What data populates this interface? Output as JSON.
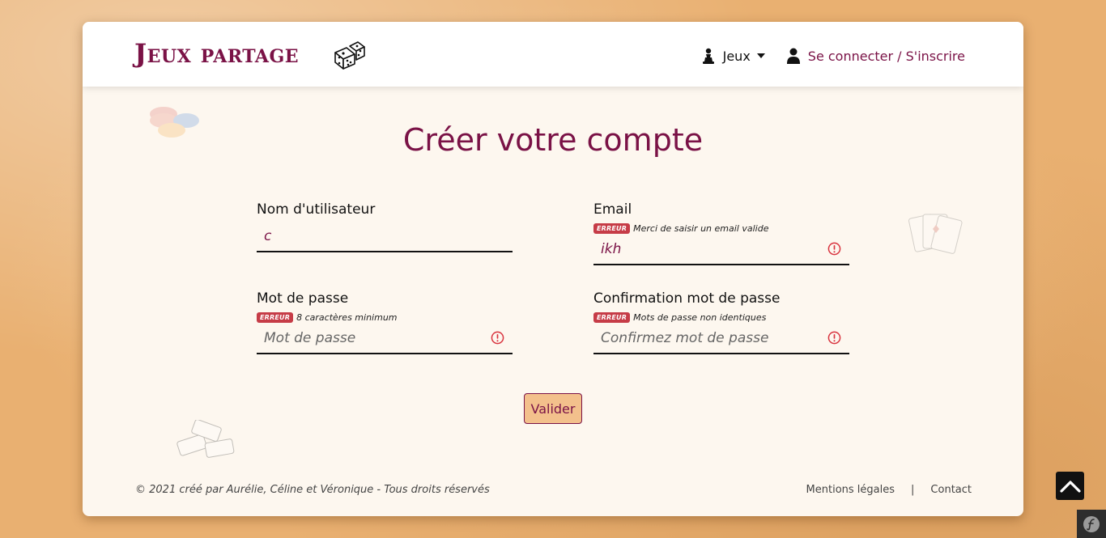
{
  "nav": {
    "brand": "Jeux partage",
    "games_label": "Jeux",
    "login_label": "Se connecter / S'inscrire"
  },
  "page": {
    "title": "Créer votre compte"
  },
  "form": {
    "username": {
      "label": "Nom d'utilisateur",
      "value": "c",
      "placeholder": ""
    },
    "email": {
      "label": "Email",
      "error_badge": "ERREUR",
      "error_text": "Merci de saisir un email valide",
      "value": "ikh",
      "placeholder": ""
    },
    "password": {
      "label": "Mot de passe",
      "error_badge": "ERREUR",
      "error_text": "8 caractères minimum",
      "value": "",
      "placeholder": "Mot de passe"
    },
    "password_confirm": {
      "label": "Confirmation mot de passe",
      "error_badge": "ERREUR",
      "error_text": "Mots de passe non identiques",
      "value": "",
      "placeholder": "Confirmez mot de passe"
    },
    "submit_label": "Valider"
  },
  "footer": {
    "copyright": "© 2021 créé par Aurélie, Céline et Véronique - Tous droits réservés",
    "legal_label": "Mentions légales",
    "separator": "|",
    "contact_label": "Contact"
  },
  "colors": {
    "brand": "#7a1246",
    "background": "#eeb878",
    "error": "#c63c47",
    "button_bg": "#f3c08c"
  },
  "icons": {
    "brand_dice": "dice-icon",
    "games": "pawn-icon",
    "login": "user-icon",
    "field_error": "alert-circle-icon",
    "back_to_top": "chevron-up-icon",
    "debug_toolbar": "symfony-icon"
  }
}
